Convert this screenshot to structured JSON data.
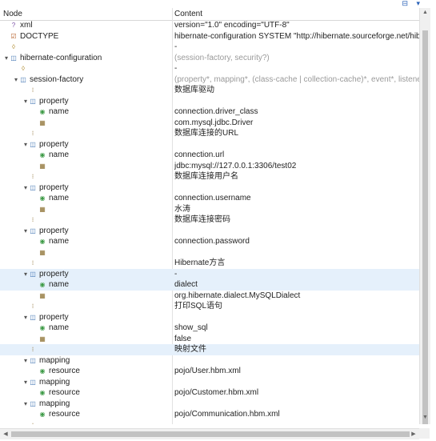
{
  "toolbar": {
    "buttons": "⊟ ▾"
  },
  "header": {
    "node": "Node",
    "content": "Content"
  },
  "rows": [
    {
      "depth": 0,
      "toggle": "",
      "icon": "?",
      "icls": "pi",
      "name": "xml",
      "content": "version=\"1.0\" encoding=\"UTF-8\""
    },
    {
      "depth": 0,
      "toggle": "",
      "icon": "☑",
      "icls": "dt",
      "name": "DOCTYPE",
      "content": "hibernate-configuration SYSTEM \"http://hibernate.sourceforge.net/hibe"
    },
    {
      "depth": 0,
      "toggle": "",
      "icon": "◊",
      "icls": "cm",
      "name": "",
      "content": "-"
    },
    {
      "depth": 0,
      "toggle": "▾",
      "icon": "◫",
      "icls": "el",
      "name": "hibernate-configuration",
      "content": "(session-factory, security?)",
      "gray": true
    },
    {
      "depth": 1,
      "toggle": "",
      "icon": "◊",
      "icls": "cm",
      "name": "",
      "content": "-"
    },
    {
      "depth": 1,
      "toggle": "▾",
      "icon": "◫",
      "icls": "el",
      "name": "session-factory",
      "content": "(property*, mapping*, (class-cache | collection-cache)*, event*, listener*)",
      "gray": true
    },
    {
      "depth": 2,
      "toggle": "",
      "icon": "⁝",
      "icls": "tx",
      "name": "",
      "content": "数据库驱动"
    },
    {
      "depth": 2,
      "toggle": "▾",
      "icon": "◫",
      "icls": "el",
      "name": "property",
      "content": ""
    },
    {
      "depth": 3,
      "toggle": "",
      "icon": "◉",
      "icls": "at",
      "name": "name",
      "content": "connection.driver_class"
    },
    {
      "depth": 3,
      "toggle": "",
      "icon": "▦",
      "icls": "tx",
      "name": "",
      "content": "com.mysql.jdbc.Driver"
    },
    {
      "depth": 2,
      "toggle": "",
      "icon": "⁝",
      "icls": "tx",
      "name": "",
      "content": "数据库连接的URL"
    },
    {
      "depth": 2,
      "toggle": "▾",
      "icon": "◫",
      "icls": "el",
      "name": "property",
      "content": ""
    },
    {
      "depth": 3,
      "toggle": "",
      "icon": "◉",
      "icls": "at",
      "name": "name",
      "content": "connection.url"
    },
    {
      "depth": 3,
      "toggle": "",
      "icon": "▦",
      "icls": "tx",
      "name": "",
      "content": "jdbc:mysql://127.0.0.1:3306/test02"
    },
    {
      "depth": 2,
      "toggle": "",
      "icon": "⁝",
      "icls": "tx",
      "name": "",
      "content": "数据库连接用户名"
    },
    {
      "depth": 2,
      "toggle": "▾",
      "icon": "◫",
      "icls": "el",
      "name": "property",
      "content": ""
    },
    {
      "depth": 3,
      "toggle": "",
      "icon": "◉",
      "icls": "at",
      "name": "name",
      "content": "connection.username"
    },
    {
      "depth": 3,
      "toggle": "",
      "icon": "▦",
      "icls": "tx",
      "name": "",
      "content": "水涛"
    },
    {
      "depth": 2,
      "toggle": "",
      "icon": "⁝",
      "icls": "tx",
      "name": "",
      "content": "数据库连接密码"
    },
    {
      "depth": 2,
      "toggle": "▾",
      "icon": "◫",
      "icls": "el",
      "name": "property",
      "content": ""
    },
    {
      "depth": 3,
      "toggle": "",
      "icon": "◉",
      "icls": "at",
      "name": "name",
      "content": "connection.password"
    },
    {
      "depth": 3,
      "toggle": "",
      "icon": "▦",
      "icls": "tx",
      "name": "",
      "content": ""
    },
    {
      "depth": 2,
      "toggle": "",
      "icon": "⁝",
      "icls": "tx",
      "name": "",
      "content": "Hibernate方言"
    },
    {
      "depth": 2,
      "toggle": "▾",
      "icon": "◫",
      "icls": "el",
      "name": "property",
      "content": "-",
      "selected": true
    },
    {
      "depth": 3,
      "toggle": "",
      "icon": "◉",
      "icls": "at",
      "name": "name",
      "content": "dialect",
      "selected": true
    },
    {
      "depth": 3,
      "toggle": "",
      "icon": "▦",
      "icls": "tx",
      "name": "",
      "content": "org.hibernate.dialect.MySQLDialect"
    },
    {
      "depth": 2,
      "toggle": "",
      "icon": "⁝",
      "icls": "tx",
      "name": "",
      "content": "打印SQL语句"
    },
    {
      "depth": 2,
      "toggle": "▾",
      "icon": "◫",
      "icls": "el",
      "name": "property",
      "content": ""
    },
    {
      "depth": 3,
      "toggle": "",
      "icon": "◉",
      "icls": "at",
      "name": "name",
      "content": "show_sql"
    },
    {
      "depth": 3,
      "toggle": "",
      "icon": "▦",
      "icls": "tx",
      "name": "",
      "content": "false"
    },
    {
      "depth": 2,
      "toggle": "",
      "icon": "⁝",
      "icls": "tx",
      "name": "",
      "content": "映射文件",
      "selected": true
    },
    {
      "depth": 2,
      "toggle": "▾",
      "icon": "◫",
      "icls": "el",
      "name": "mapping",
      "content": ""
    },
    {
      "depth": 3,
      "toggle": "",
      "icon": "◉",
      "icls": "at",
      "name": "resource",
      "content": "pojo/User.hbm.xml"
    },
    {
      "depth": 2,
      "toggle": "▾",
      "icon": "◫",
      "icls": "el",
      "name": "mapping",
      "content": ""
    },
    {
      "depth": 3,
      "toggle": "",
      "icon": "◉",
      "icls": "at",
      "name": "resource",
      "content": "pojo/Customer.hbm.xml"
    },
    {
      "depth": 2,
      "toggle": "▾",
      "icon": "◫",
      "icls": "el",
      "name": "mapping",
      "content": ""
    },
    {
      "depth": 3,
      "toggle": "",
      "icon": "◉",
      "icls": "at",
      "name": "resource",
      "content": "pojo/Communication.hbm.xml"
    },
    {
      "depth": 2,
      "toggle": "",
      "icon": "⁝",
      "icls": "tx",
      "name": "",
      "content": "-"
    }
  ]
}
